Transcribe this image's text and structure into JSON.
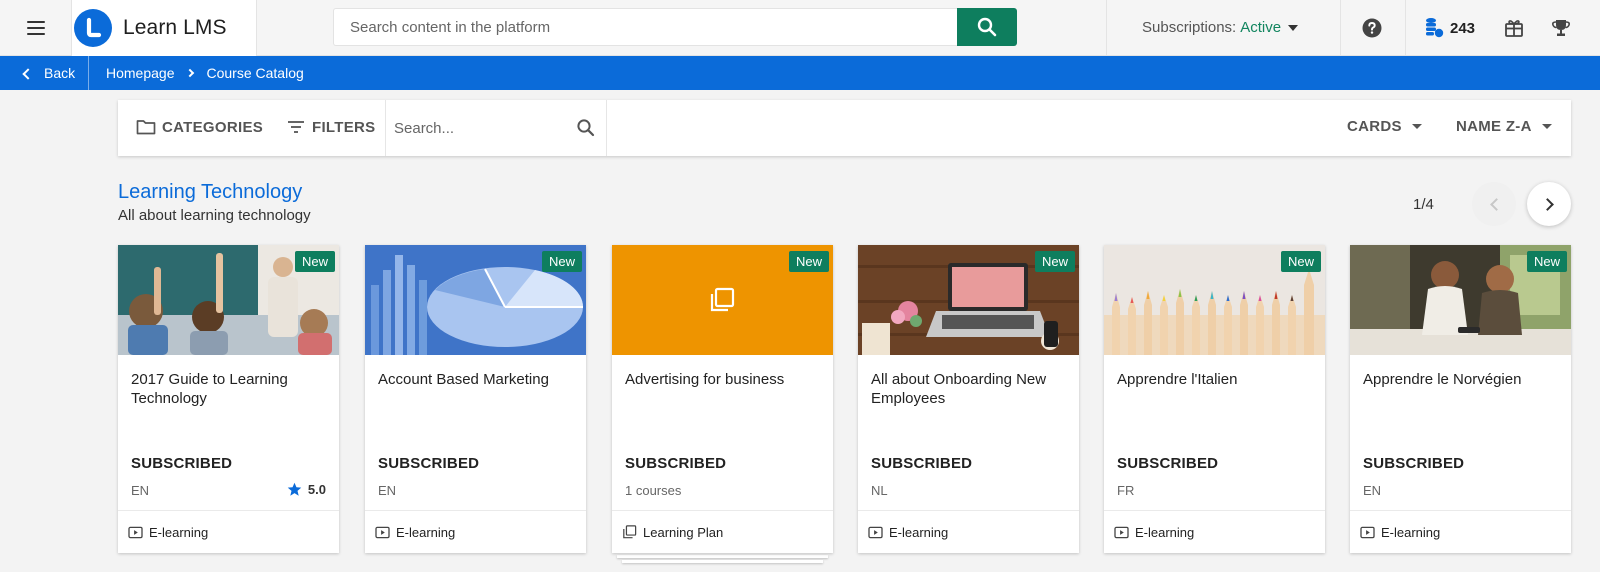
{
  "header": {
    "brand": "Learn LMS",
    "search_placeholder": "Search content in the platform",
    "subscriptions_label": "Subscriptions:",
    "subscriptions_status": "Active",
    "credits": "243",
    "colors": {
      "primary": "#0b6bd9",
      "accent_green": "#0e7e5e",
      "status_green": "#12855f"
    }
  },
  "breadcrumb": {
    "back_label": "Back",
    "items": [
      "Homepage",
      "Course Catalog"
    ]
  },
  "toolbar": {
    "categories_label": "CATEGORIES",
    "filters_label": "FILTERS",
    "search_placeholder": "Search...",
    "view_label": "CARDS",
    "sort_label": "NAME Z-A"
  },
  "section": {
    "title": "Learning Technology",
    "subtitle": "All about learning technology",
    "pager": "1/4"
  },
  "cards": [
    {
      "badge": "New",
      "title": "2017 Guide to Learning Technology",
      "status": "SUBSCRIBED",
      "meta": "EN",
      "rating": "5.0",
      "type": "E-learning",
      "thumb_icon": "classroom-image"
    },
    {
      "badge": "New",
      "title": "Account Based Marketing",
      "status": "SUBSCRIBED",
      "meta": "EN",
      "type": "E-learning",
      "thumb_icon": "chart-image"
    },
    {
      "badge": "New",
      "title": "Advertising for business",
      "status": "SUBSCRIBED",
      "meta": "1 courses",
      "type": "Learning Plan",
      "thumb_icon": "learning-plan-icon",
      "thumb_color": "#ee9400"
    },
    {
      "badge": "New",
      "title": "All about Onboarding New Employees",
      "status": "SUBSCRIBED",
      "meta": "NL",
      "type": "E-learning",
      "thumb_icon": "laptop-desk-image"
    },
    {
      "badge": "New",
      "title": "Apprendre l'Italien",
      "status": "SUBSCRIBED",
      "meta": "FR",
      "type": "E-learning",
      "thumb_icon": "pencils-image"
    },
    {
      "badge": "New",
      "title": "Apprendre le Norvégien",
      "status": "SUBSCRIBED",
      "meta": "EN",
      "type": "E-learning",
      "thumb_icon": "people-image"
    }
  ]
}
